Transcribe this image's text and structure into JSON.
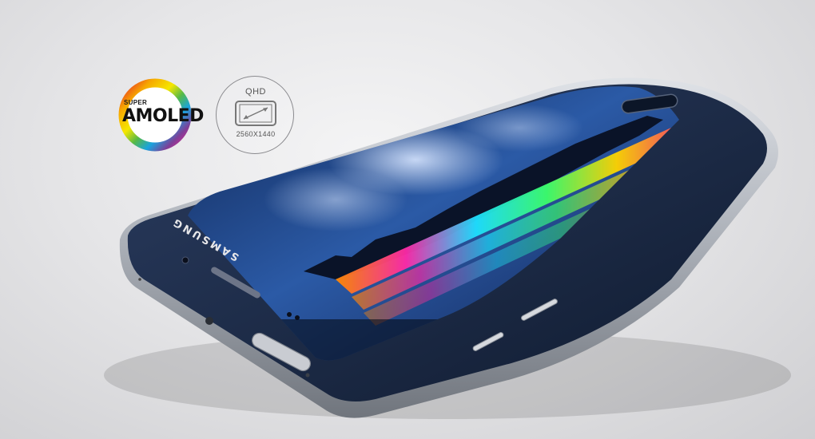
{
  "badges": {
    "amoled": {
      "super_label": "SUPER",
      "main_label": "AMOLED",
      "ring_colors": [
        "#e8232a",
        "#f6a800",
        "#f5e700",
        "#56b947",
        "#1aa3de",
        "#7d3f98",
        "#e8238c"
      ]
    },
    "qhd": {
      "title": "QHD",
      "resolution": "2560X1440",
      "icon": "screen-diagonal-icon"
    }
  },
  "phone": {
    "brand": "SAMSUNG",
    "body_color": "#1b2a45",
    "frame_color": "#b8bcc4"
  },
  "colors": {
    "background": "#e6e6e8",
    "screen_sky": "#1c3f7c"
  }
}
